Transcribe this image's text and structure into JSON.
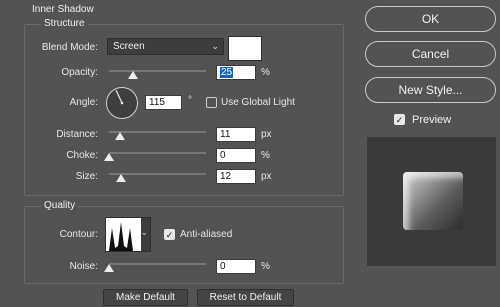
{
  "header": {
    "section_title": "Inner Shadow"
  },
  "structure": {
    "legend": "Structure",
    "blend_mode": {
      "label": "Blend Mode:",
      "value": "Screen"
    },
    "blend_color": "#ffffff",
    "opacity": {
      "label": "Opacity:",
      "value": "25",
      "unit": "%",
      "level": 0.25
    },
    "angle": {
      "label": "Angle:",
      "value": "115",
      "unit": "°",
      "degrees": 115
    },
    "use_global_light": {
      "label": "Use Global Light",
      "checked": false
    },
    "distance": {
      "label": "Distance:",
      "value": "11",
      "unit": "px",
      "level": 0.11
    },
    "choke": {
      "label": "Choke:",
      "value": "0",
      "unit": "%",
      "level": 0
    },
    "size": {
      "label": "Size:",
      "value": "12",
      "unit": "px",
      "level": 0.12
    }
  },
  "quality": {
    "legend": "Quality",
    "contour": {
      "label": "Contour:",
      "icon": "contour-preview-icon"
    },
    "anti_aliased": {
      "label": "Anti-aliased",
      "checked": true
    },
    "noise": {
      "label": "Noise:",
      "value": "0",
      "unit": "%",
      "level": 0
    }
  },
  "footer": {
    "make_default": "Make Default",
    "reset_default": "Reset to Default"
  },
  "actions": {
    "ok": "OK",
    "cancel": "Cancel",
    "new_style": "New Style...",
    "preview": {
      "label": "Preview",
      "checked": true
    }
  }
}
